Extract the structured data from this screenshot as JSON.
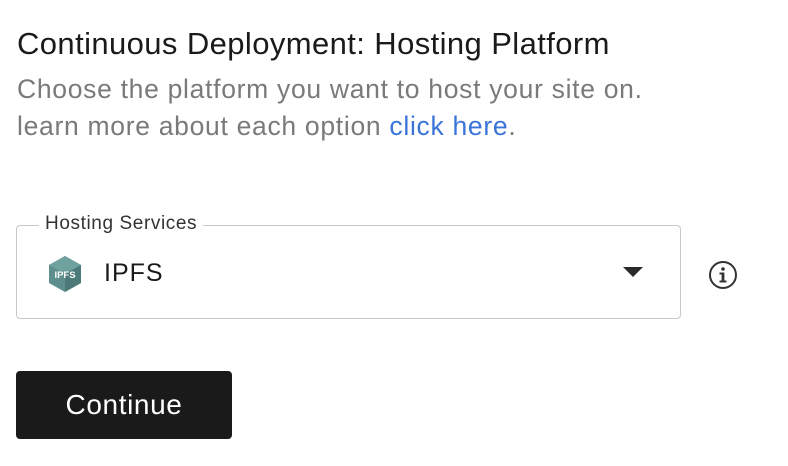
{
  "header": {
    "title": "Continuous Deployment: Hosting Platform",
    "description_line1": "Choose the platform you want to host your site on.",
    "description_line2_prefix": "learn more about each option ",
    "description_link": "click here",
    "description_line2_suffix": "."
  },
  "hosting_select": {
    "label": "Hosting Services",
    "selected_value": "IPFS",
    "selected_icon": "ipfs-logo-icon",
    "dropdown_icon": "caret-down-icon",
    "logo_text": "IPFS"
  },
  "info_icon": "info-circle-icon",
  "actions": {
    "continue_label": "Continue"
  },
  "colors": {
    "link": "#3a74d9",
    "button_bg": "#1a1a1a",
    "ipfs_logo": "#5e8f8c"
  }
}
